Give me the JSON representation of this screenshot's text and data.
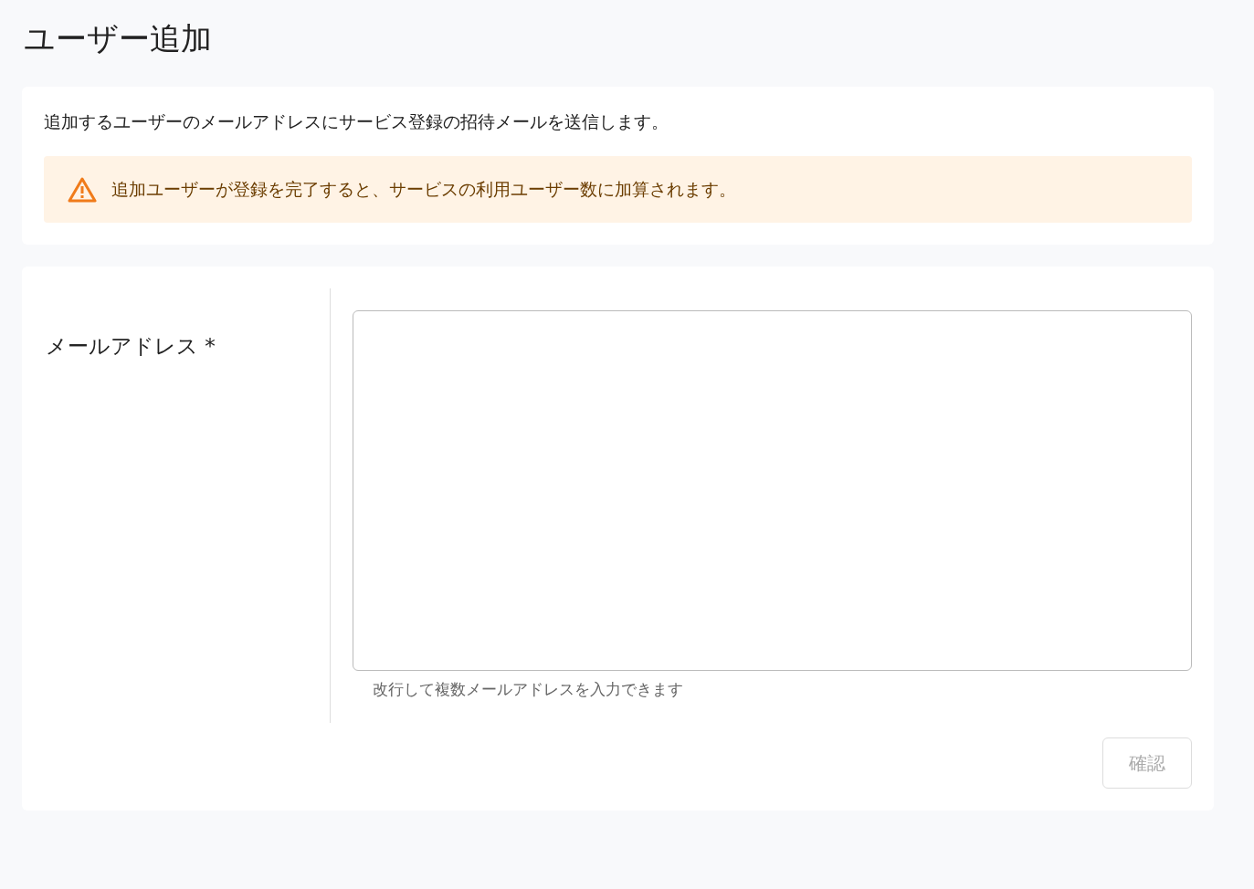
{
  "page_title": "ユーザー追加",
  "intro": {
    "text": "追加するユーザーのメールアドレスにサービス登録の招待メールを送信します。"
  },
  "alert": {
    "kind": "warning",
    "text": "追加ユーザーが登録を完了すると、サービスの利用ユーザー数に加算されます。"
  },
  "form": {
    "label": "メールアドレス",
    "required_mark": "*",
    "help": "改行して複数メールアドレスを入力できます"
  },
  "confirm_button": {
    "label": "確認",
    "disabled": true
  }
}
